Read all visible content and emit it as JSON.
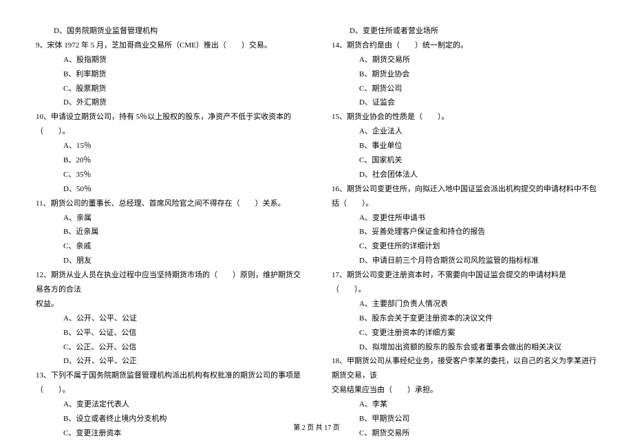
{
  "leftColumn": {
    "l0": "D、国务院期货业监督管理机构",
    "q9": "9、宋体 1972 年 5 月，芝加哥商业交易所（CME）推出（　　）交易。",
    "q9a": "A、股指期货",
    "q9b": "B、利率期货",
    "q9c": "C、股票期货",
    "q9d": "D、外汇期货",
    "q10": "10、申请设立期货公司，持有 5％以上股权的股东，净资产不低于实收资本的（　　）。",
    "q10a": "A、15％",
    "q10b": "B、20％",
    "q10c": "C、35％",
    "q10d": "D、50％",
    "q11": "11、期货公司的董事长、总经理、首席风险官之间不得存在（　　）关系。",
    "q11a": "A、亲属",
    "q11b": "B、近亲属",
    "q11c": "C、亲戚",
    "q11d": "D、朋友",
    "q12": "12、期货从业人员在执业过程中应当坚持期货市场的（　　）原则，维护期货交易各方的合法",
    "q12_cont": "权益。",
    "q12a": "A、公开、公平、公证",
    "q12b": "B、公平、公证、公信",
    "q12c": "C、公正、公开、公信",
    "q12d": "D、公开、公平、公正",
    "q13": "13、下列不属于国务院期货监督管理机构派出机构有权批准的期货公司的事项是（　　）。",
    "q13a": "A、变更法定代表人",
    "q13b": "B、设立或者终止境内分支机构",
    "q13c": "C、变更注册资本"
  },
  "rightColumn": {
    "r0": "D、变更住所或者营业场所",
    "q14": "14、期货合约是由（　　）统一制定的。",
    "q14a": "A、期货交易所",
    "q14b": "B、期货业协会",
    "q14c": "C、期货公司",
    "q14d": "D、证监会",
    "q15": "15、期货业协会的性质是（　　）。",
    "q15a": "A、企业法人",
    "q15b": "B、事业单位",
    "q15c": "C、国家机关",
    "q15d": "D、社会团体法人",
    "q16": "16、期货公司变更住所，向拟迁入地中国证监会派出机构提交的申请材料中不包括（　　）。",
    "q16a": "A、变更住所申请书",
    "q16b": "B、妥善处理客户保证金和持仓的报告",
    "q16c": "C、变更住所的详细计划",
    "q16d": "D、申请日前三个月符合期货公司风险监管的指标标准",
    "q17": "17、期货公司变更注册资本时，不需要向中国证监会提交的申请材料是（　　）。",
    "q17a": "A、主要部门负责人情况表",
    "q17b": "B、股东会关于变更注册资本的决议文件",
    "q17c": "C、变更注册资本的详细方案",
    "q17d": "D、拟增加出资额的股东的股东会或者董事会做出的相关决议",
    "q18": "18、甲期货公司从事经纪业务，接受客户李某的委托，以自己的名义为李某进行期货交易，该",
    "q18_cont": "交易结果应当由（　　）承担。",
    "q18a": "A、李某",
    "q18b": "B、甲期货公司",
    "q18c": "C、期货交易所"
  },
  "footer": "第 2 页 共 17 页"
}
